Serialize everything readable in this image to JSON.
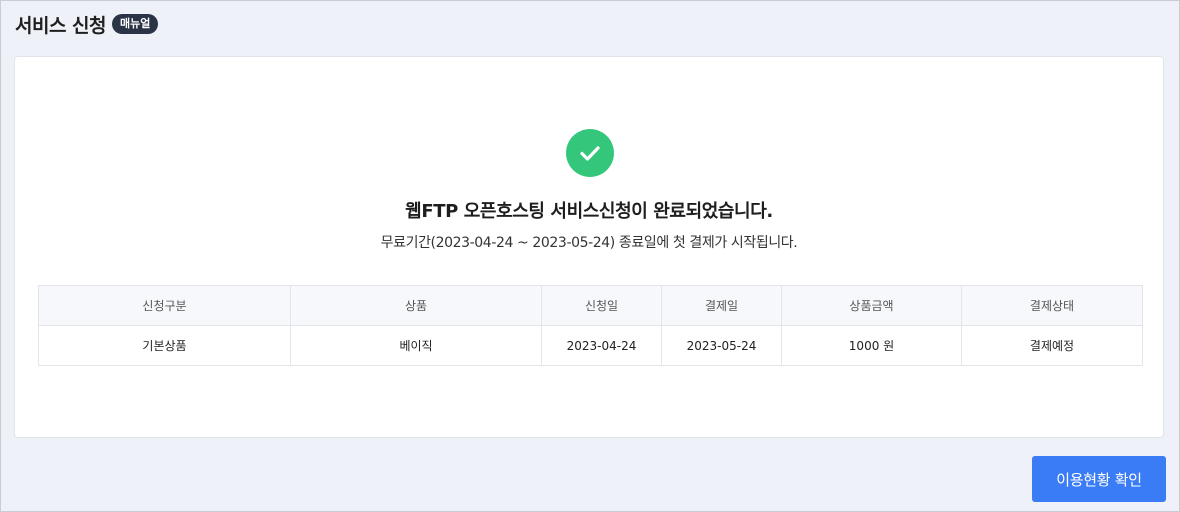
{
  "header": {
    "title": "서비스 신청",
    "badge": "매뉴얼"
  },
  "result": {
    "icon": "check-circle-icon",
    "icon_color": "#34c77b",
    "headline": "웹FTP 오픈호스팅 서비스신청이 완료되었습니다.",
    "subline": "무료기간(2023-04-24 ~ 2023-05-24) 종료일에 첫 결제가 시작됩니다."
  },
  "table": {
    "columns": [
      "신청구분",
      "상품",
      "신청일",
      "결제일",
      "상품금액",
      "결제상태"
    ],
    "rows": [
      [
        "기본상품",
        "베이직",
        "2023-04-24",
        "2023-05-24",
        "1000 원",
        "결제예정"
      ]
    ]
  },
  "footer": {
    "confirm_label": "이용현황 확인",
    "confirm_color": "#3a7cf6"
  }
}
